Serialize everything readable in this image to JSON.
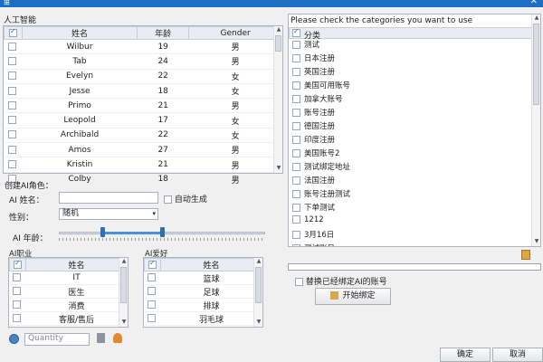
{
  "window": {
    "close_glyph": "✕",
    "icon_glyph": "⊞"
  },
  "left": {
    "section_label": "人工智能",
    "people_table": {
      "columns": [
        "姓名",
        "年龄",
        "Gender"
      ],
      "rows": [
        {
          "name": "Wilbur",
          "age": "19",
          "gender": "男"
        },
        {
          "name": "Tab",
          "age": "24",
          "gender": "男"
        },
        {
          "name": "Evelyn",
          "age": "22",
          "gender": "女"
        },
        {
          "name": "Jesse",
          "age": "18",
          "gender": "女"
        },
        {
          "name": "Primo",
          "age": "21",
          "gender": "男"
        },
        {
          "name": "Leopold",
          "age": "17",
          "gender": "女"
        },
        {
          "name": "Archibald",
          "age": "22",
          "gender": "女"
        },
        {
          "name": "Amos",
          "age": "27",
          "gender": "男"
        },
        {
          "name": "Kristin",
          "age": "21",
          "gender": "男"
        },
        {
          "name": "Colby",
          "age": "18",
          "gender": "男"
        }
      ]
    },
    "create_label": "创建AI角色：",
    "ai_name_label": "AI 姓名：",
    "ai_name_value": "",
    "auto_generate_label": "自动生成",
    "gender_label": "性别：",
    "gender_value": "随机",
    "age_label": "AI 年龄：",
    "age_range": {
      "low": 0.21,
      "high": 0.5
    },
    "job_list": {
      "title": "AI职业",
      "column": "姓名",
      "items": [
        "IT",
        "医生",
        "消费",
        "客服/售后"
      ]
    },
    "hobby_list": {
      "title": "AI爱好",
      "column": "姓名",
      "items": [
        "篮球",
        "足球",
        "排球",
        "羽毛球"
      ]
    },
    "quantity_placeholder": "Quantity"
  },
  "right": {
    "header_label": "Please check the categories you want to use",
    "column": "分类",
    "categories": [
      "测试",
      "日本注册",
      "英国注册",
      "美国可用账号",
      "加拿大账号",
      "账号注册",
      "德国注册",
      "印度注册",
      "美国账号2",
      "测试绑定地址",
      "法国注册",
      "账号注册测试",
      "下单测试",
      "1212",
      "3月16日",
      "测试账号"
    ],
    "replace_label": "替换已经绑定AI的账号",
    "start_bind_label": "开始绑定"
  },
  "footer": {
    "ok_label": "确定",
    "cancel_label": "取消"
  },
  "colors": {
    "accent": "#1e6fc4",
    "slider_fill": "#4a90d9"
  }
}
